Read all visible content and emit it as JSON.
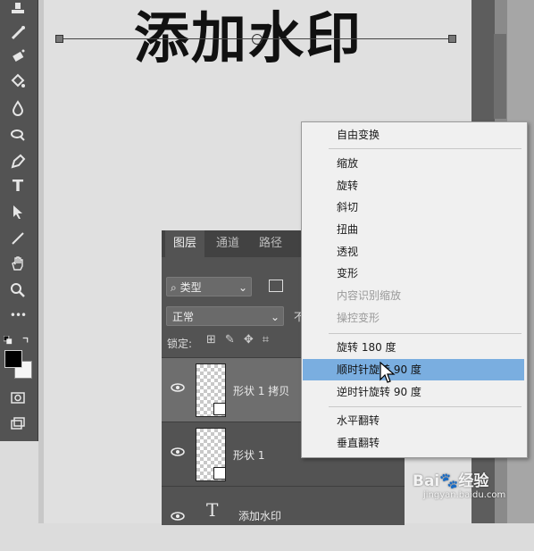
{
  "canvas": {
    "title_text": "添加水印"
  },
  "toolbar": {
    "tools": [
      "stamp-icon",
      "healing-brush-icon",
      "magic-eraser-icon",
      "paint-bucket-icon",
      "blur-icon",
      "dodge-icon",
      "pen-icon",
      "type-icon",
      "path-selection-icon",
      "line-icon",
      "hand-icon",
      "zoom-icon",
      "more-tools-icon"
    ],
    "type_glyph": "T",
    "more_glyph": "•••",
    "fg_color": "#000000",
    "bg_color": "#f5f5f5"
  },
  "layers_panel": {
    "tabs": [
      "图层",
      "通道",
      "路径"
    ],
    "filter_label": "类型",
    "blend_mode": "正常",
    "opacity_label": "不",
    "lock_label": "锁定:",
    "layers": [
      {
        "name": "形状 1 拷贝",
        "selected": true
      },
      {
        "name": "形状 1",
        "selected": false
      },
      {
        "name": "添加水印",
        "selected": false
      }
    ],
    "text_layer_glyph": "T"
  },
  "context_menu": {
    "group1": [
      "自由变换"
    ],
    "group2": [
      "缩放",
      "旋转",
      "斜切",
      "扭曲",
      "透视",
      "变形",
      "内容识别缩放",
      "操控变形"
    ],
    "disabled_items": [
      "内容识别缩放",
      "操控变形"
    ],
    "group3": [
      "旋转 180 度",
      "顺时针旋转 90 度",
      "逆时针旋转 90 度"
    ],
    "highlighted_item": "顺时针旋转 90 度",
    "group4": [
      "水平翻转",
      "垂直翻转"
    ]
  },
  "watermark": {
    "brand": "Bai",
    "brand_suffix": "经验",
    "url": "jingyan.baidu.com"
  },
  "colors": {
    "menu_highlight": "#7aaee0",
    "panel_bg": "#535353",
    "selected_layer": "#6e6e6e"
  }
}
